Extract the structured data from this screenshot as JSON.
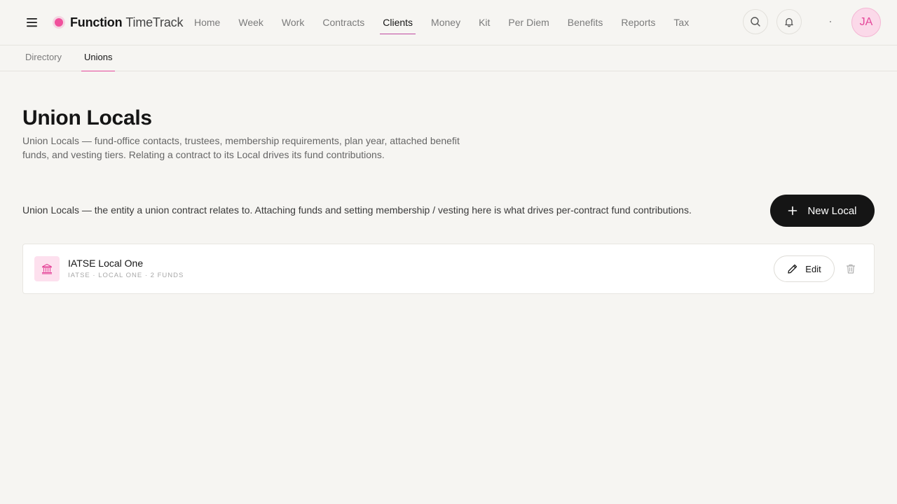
{
  "brand": {
    "name_bold": "Function",
    "name_light": "TimeTrack",
    "accent_color": "#f0509c"
  },
  "nav": {
    "items": [
      {
        "label": "Home"
      },
      {
        "label": "Week"
      },
      {
        "label": "Work"
      },
      {
        "label": "Contracts"
      },
      {
        "label": "Clients",
        "active": true
      },
      {
        "label": "Money"
      },
      {
        "label": "Kit"
      },
      {
        "label": "Per Diem"
      },
      {
        "label": "Benefits"
      },
      {
        "label": "Reports"
      },
      {
        "label": "Tax"
      }
    ]
  },
  "header_icons": [
    "hamburger-icon",
    "search-icon",
    "bell-icon"
  ],
  "user": {
    "initials": "JA"
  },
  "subnav": {
    "items": [
      {
        "label": "Directory"
      },
      {
        "label": "Unions",
        "active": true
      }
    ]
  },
  "page": {
    "title": "Union Locals",
    "description": "Union Locals — fund-office contacts, trustees, membership requirements, plan year, attached benefit funds, and vesting tiers. Relating a contract to its Local drives its fund contributions.",
    "info": "Union Locals — the entity a union contract relates to. Attaching funds and setting membership / vesting here is what drives per-contract fund contributions.",
    "new_button_label": "New Local"
  },
  "locals": [
    {
      "name": "IATSE Local One",
      "meta": "IATSE · LOCAL ONE · 2 FUNDS",
      "icon": "bank-icon",
      "edit_label": "Edit"
    }
  ]
}
